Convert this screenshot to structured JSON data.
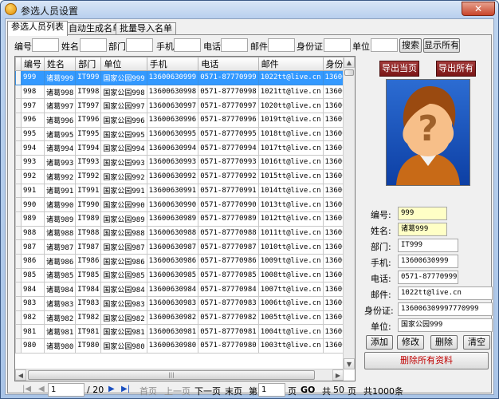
{
  "window": {
    "title": "参选人员设置",
    "close_label": "✕"
  },
  "tabs": [
    {
      "label": "参选人员列表",
      "active": true
    },
    {
      "label": "自动生成名单",
      "active": false
    },
    {
      "label": "批量导入名单",
      "active": false
    }
  ],
  "filters": {
    "id_label": "编号",
    "name_label": "姓名",
    "dept_label": "部门",
    "mobile_label": "手机",
    "phone_label": "电话",
    "email_label": "邮件",
    "idcard_label": "身份证",
    "unit_label": "单位",
    "search_label": "搜索",
    "show_all_label": "显示所有"
  },
  "table": {
    "columns": [
      "编号",
      "姓名",
      "部门",
      "单位",
      "手机",
      "电话",
      "邮件",
      "身份证"
    ],
    "rows": [
      [
        "999",
        "诸葛999",
        "IT999",
        "国家公园999",
        "13600630999",
        "0571-87770999",
        "1022tt@live.cn",
        "13600630"
      ],
      [
        "998",
        "诸葛998",
        "IT998",
        "国家公园998",
        "13600630998",
        "0571-87770998",
        "1021tt@live.cn",
        "13600630"
      ],
      [
        "997",
        "诸葛997",
        "IT997",
        "国家公园997",
        "13600630997",
        "0571-87770997",
        "1020tt@live.cn",
        "13600630"
      ],
      [
        "996",
        "诸葛996",
        "IT996",
        "国家公园996",
        "13600630996",
        "0571-87770996",
        "1019tt@live.cn",
        "13600630"
      ],
      [
        "995",
        "诸葛995",
        "IT995",
        "国家公园995",
        "13600630995",
        "0571-87770995",
        "1018tt@live.cn",
        "13600630"
      ],
      [
        "994",
        "诸葛994",
        "IT994",
        "国家公园994",
        "13600630994",
        "0571-87770994",
        "1017tt@live.cn",
        "13600630"
      ],
      [
        "993",
        "诸葛993",
        "IT993",
        "国家公园993",
        "13600630993",
        "0571-87770993",
        "1016tt@live.cn",
        "13600630"
      ],
      [
        "992",
        "诸葛992",
        "IT992",
        "国家公园992",
        "13600630992",
        "0571-87770992",
        "1015tt@live.cn",
        "13600630"
      ],
      [
        "991",
        "诸葛991",
        "IT991",
        "国家公园991",
        "13600630991",
        "0571-87770991",
        "1014tt@live.cn",
        "13600630"
      ],
      [
        "990",
        "诸葛990",
        "IT990",
        "国家公园990",
        "13600630990",
        "0571-87770990",
        "1013tt@live.cn",
        "13600630"
      ],
      [
        "989",
        "诸葛989",
        "IT989",
        "国家公园989",
        "13600630989",
        "0571-87770989",
        "1012tt@live.cn",
        "13600630"
      ],
      [
        "988",
        "诸葛988",
        "IT988",
        "国家公园988",
        "13600630988",
        "0571-87770988",
        "1011tt@live.cn",
        "13600630"
      ],
      [
        "987",
        "诸葛987",
        "IT987",
        "国家公园987",
        "13600630987",
        "0571-87770987",
        "1010tt@live.cn",
        "13600630"
      ],
      [
        "986",
        "诸葛986",
        "IT986",
        "国家公园986",
        "13600630986",
        "0571-87770986",
        "1009tt@live.cn",
        "13600630"
      ],
      [
        "985",
        "诸葛985",
        "IT985",
        "国家公园985",
        "13600630985",
        "0571-87770985",
        "1008tt@live.cn",
        "13600630"
      ],
      [
        "984",
        "诸葛984",
        "IT984",
        "国家公园984",
        "13600630984",
        "0571-87770984",
        "1007tt@live.cn",
        "13600630"
      ],
      [
        "983",
        "诸葛983",
        "IT983",
        "国家公园983",
        "13600630983",
        "0571-87770983",
        "1006tt@live.cn",
        "13600630"
      ],
      [
        "982",
        "诸葛982",
        "IT982",
        "国家公园982",
        "13600630982",
        "0571-87770982",
        "1005tt@live.cn",
        "13600630"
      ],
      [
        "981",
        "诸葛981",
        "IT981",
        "国家公园981",
        "13600630981",
        "0571-87770981",
        "1004tt@live.cn",
        "13600630"
      ],
      [
        "980",
        "诸葛980",
        "IT980",
        "国家公园980",
        "13600630980",
        "0571-87770980",
        "1003tt@live.cn",
        "13600630"
      ]
    ],
    "selected_index": 0
  },
  "export": {
    "current_label": "导出当页",
    "all_label": "导出所有"
  },
  "avatar": {
    "icon": "unknown-person-icon",
    "symbol": "?"
  },
  "detail": {
    "id_label": "编号:",
    "id_value": "999",
    "name_label": "姓名:",
    "name_value": "诸葛999",
    "dept_label": "部门:",
    "dept_value": "IT999",
    "mobile_label": "手机:",
    "mobile_value": "13600630999",
    "phone_label": "电话:",
    "phone_value": "0571-87770999",
    "email_label": "邮件:",
    "email_value": "1022tt@live.cn",
    "idcard_label": "身份证:",
    "idcard_value": "136006309997770999",
    "unit_label": "单位:",
    "unit_value": "国家公园999",
    "add_label": "添加",
    "edit_label": "修改",
    "delete_label": "删除",
    "clear_label": "清空",
    "delete_all_label": "删除所有资料"
  },
  "pager": {
    "page_value": "1",
    "total_pages": "/ 20",
    "first_label": "首页",
    "prev_label": "上一页",
    "next_label": "下一页",
    "last_label": "末页",
    "goto_prefix": "第",
    "goto_value": "1",
    "goto_suffix": "页",
    "go_label": "GO",
    "size_prefix": "共",
    "size_value": "50",
    "size_suffix": "页",
    "total_label": "共1000条"
  },
  "colors": {
    "selected_row": "#3399ff",
    "danger_text": "#c00000",
    "export_button": "#8b2020",
    "highlight_field": "#ffffc6"
  }
}
